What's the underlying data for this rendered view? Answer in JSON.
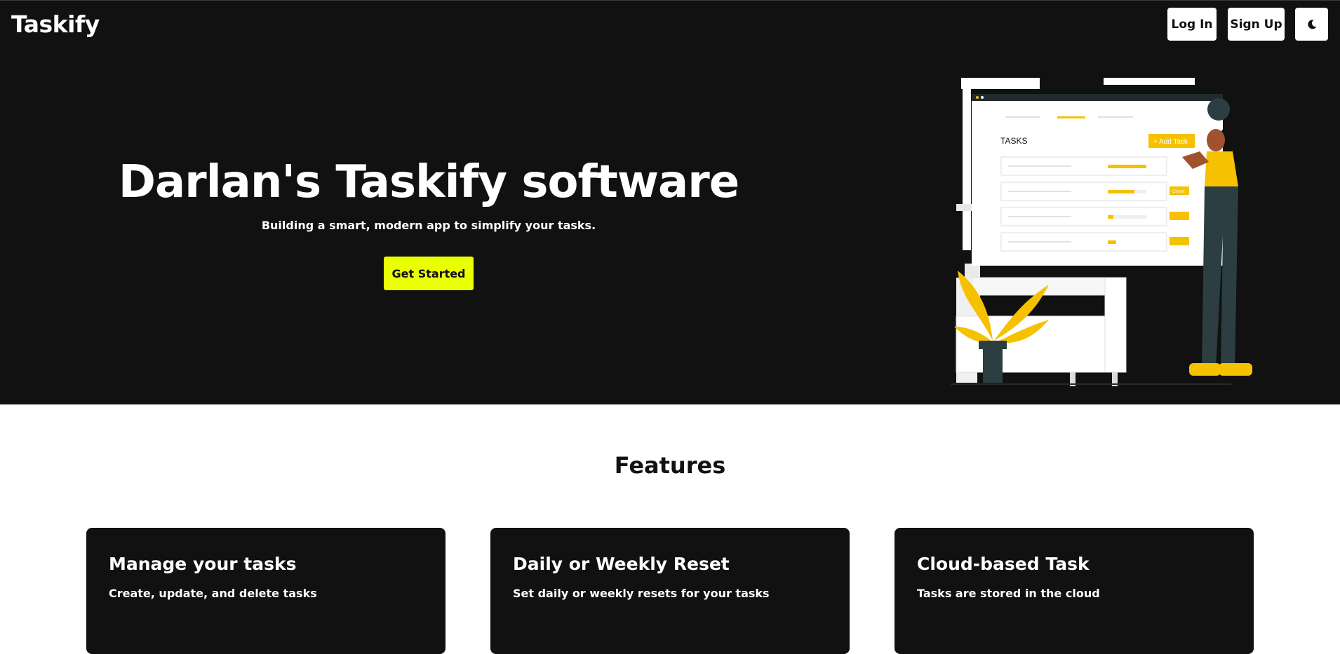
{
  "header": {
    "brand": "Taskify",
    "login_label": "Log In",
    "signup_label": "Sign Up",
    "theme_icon": "moon-icon"
  },
  "hero": {
    "title": "Darlan's Taskify software",
    "subtitle": "Building a smart, modern app to simplify your tasks.",
    "cta_label": "Get Started",
    "illustration": {
      "panel_title": "TASKS",
      "add_button": "+ Add Task",
      "row_button": "Check"
    }
  },
  "features": {
    "title": "Features",
    "cards": [
      {
        "title": "Manage your tasks",
        "description": "Create, update, and delete tasks"
      },
      {
        "title": "Daily or Weekly Reset",
        "description": "Set daily or weekly resets for your tasks"
      },
      {
        "title": "Cloud-based Task",
        "description": "Tasks are stored in the cloud"
      }
    ]
  },
  "colors": {
    "dark": "#111111",
    "accent": "#eaff00",
    "illustration_yellow": "#f6c100",
    "illustration_teal": "#2c3e42"
  }
}
